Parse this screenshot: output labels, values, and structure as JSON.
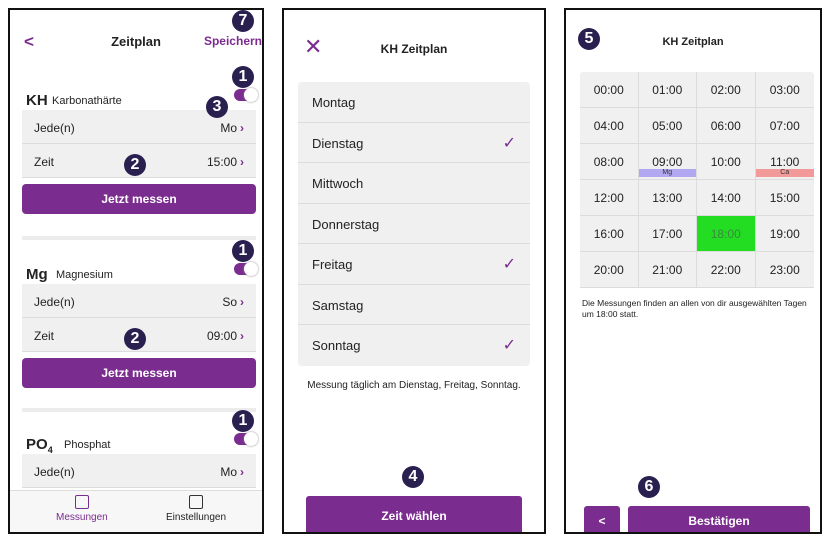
{
  "panel1": {
    "back": "<",
    "title": "Zeitplan",
    "save": "Speichern",
    "params": [
      {
        "symbol": "KH",
        "name": "Karbonathärte",
        "jede_label": "Jede(n)",
        "jede_value": "Mo",
        "zeit_label": "Zeit",
        "zeit_value": "15:00",
        "button": "Jetzt messen"
      },
      {
        "symbol": "Mg",
        "name": "Magnesium",
        "jede_label": "Jede(n)",
        "jede_value": "So",
        "zeit_label": "Zeit",
        "zeit_value": "09:00",
        "button": "Jetzt messen"
      },
      {
        "symbol": "PO",
        "symbol_sub": "4",
        "name": "Phosphat",
        "jede_label": "Jede(n)",
        "jede_value": "Mo"
      }
    ],
    "nav": [
      {
        "label": "Messungen",
        "icon": "measurements-icon",
        "active": true
      },
      {
        "label": "Einstellungen",
        "icon": "settings-icon",
        "active": false
      }
    ]
  },
  "panel2": {
    "close": "✕",
    "title": "KH Zeitplan",
    "days": [
      {
        "label": "Montag",
        "checked": false
      },
      {
        "label": "Dienstag",
        "checked": true
      },
      {
        "label": "Mittwoch",
        "checked": false
      },
      {
        "label": "Donnerstag",
        "checked": false
      },
      {
        "label": "Freitag",
        "checked": true
      },
      {
        "label": "Samstag",
        "checked": false
      },
      {
        "label": "Sonntag",
        "checked": true
      }
    ],
    "check_mark": "✓",
    "note": "Messung täglich am Dienstag, Freitag, Sonntag.",
    "button": "Zeit wählen"
  },
  "panel3": {
    "title": "KH Zeitplan",
    "times": [
      "00:00",
      "01:00",
      "02:00",
      "03:00",
      "04:00",
      "05:00",
      "06:00",
      "07:00",
      "08:00",
      "09:00",
      "10:00",
      "11:00",
      "12:00",
      "13:00",
      "14:00",
      "15:00",
      "16:00",
      "17:00",
      "18:00",
      "19:00",
      "20:00",
      "21:00",
      "22:00",
      "23:00"
    ],
    "selected": "18:00",
    "tags": {
      "09:00": "Mg",
      "11:00": "Ca"
    },
    "note": "Die Messungen finden an allen von dir ausgewählten Tagen um 18:00 statt.",
    "back": "<",
    "confirm": "Bestätigen"
  },
  "callouts": [
    "1",
    "2",
    "3",
    "4",
    "5",
    "6",
    "7"
  ],
  "colors": {
    "accent": "#7b2c8f",
    "selected_cell": "#22dd22",
    "tag_mg": "#b0a8f0",
    "tag_ca": "#f29a9a",
    "callout": "#2a2050"
  }
}
